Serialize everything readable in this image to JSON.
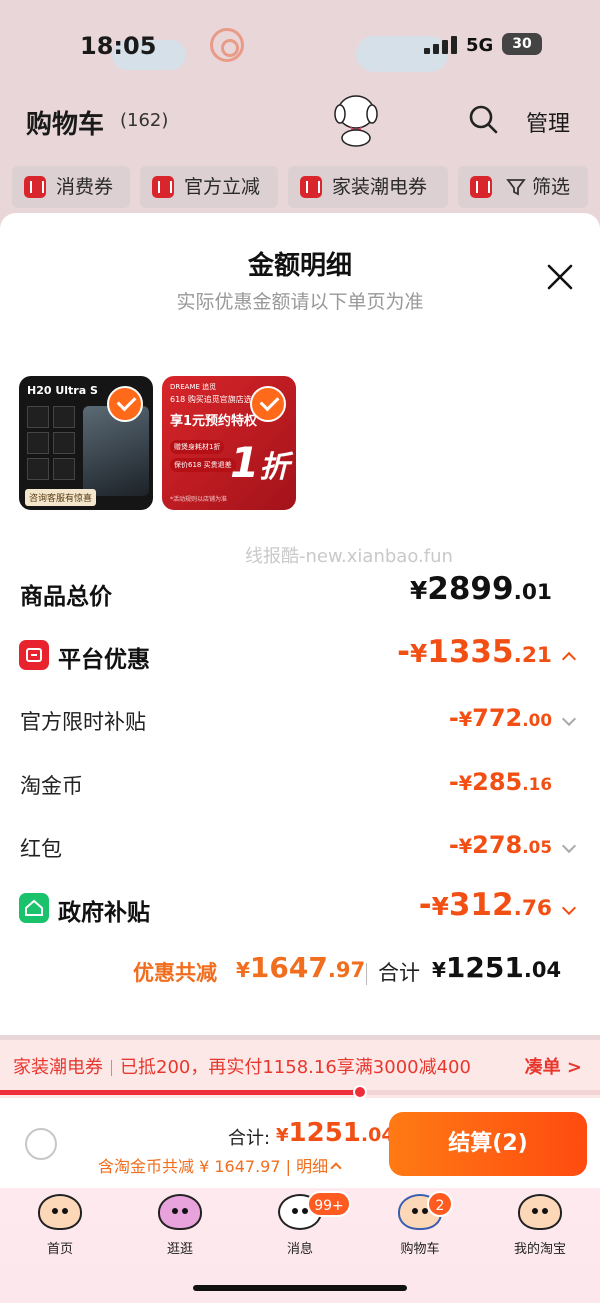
{
  "status_bar": {
    "time": "18:05",
    "network": "5G",
    "battery": "30"
  },
  "cart": {
    "title": "购物车",
    "count": "(162)",
    "manage": "管理"
  },
  "chips": [
    {
      "label": "消费券"
    },
    {
      "label": "官方立减"
    },
    {
      "label": "家装潮电券"
    },
    {
      "label": "筛选"
    }
  ],
  "sheet": {
    "title": "金额明细",
    "subtitle": "实际优惠金额请以下单页为准",
    "watermark": "线报酷-new.xianbao.fun",
    "products": [
      {
        "title": "H20 Ultra S",
        "tag": "咨询客服有惊喜"
      },
      {
        "brand": "DREAME 追觅",
        "line1": "618 购买追觅官旗店选地机",
        "line2": "享1元预约特权",
        "pill1": "赠煲身耗材1折",
        "pill2": "保价618 买贵退差",
        "big": "1",
        "big_unit": "折",
        "foot": "*活动规则以店铺为准"
      }
    ],
    "rows": {
      "total": {
        "label": "商品总价",
        "yen": "¥",
        "int": "2899",
        "dec": ".01"
      },
      "platform": {
        "label": "平台优惠",
        "sign": "-",
        "yen": "¥",
        "int": "1335",
        "dec": ".21"
      },
      "official": {
        "label": "官方限时补贴",
        "sign": "-",
        "yen": "¥",
        "int": "772",
        "dec": ".00"
      },
      "coins": {
        "label": "淘金币",
        "sign": "-",
        "yen": "¥",
        "int": "285",
        "dec": ".16"
      },
      "redpack": {
        "label": "红包",
        "sign": "-",
        "yen": "¥",
        "int": "278",
        "dec": ".05"
      },
      "gov": {
        "label": "政府补贴",
        "sign": "-",
        "yen": "¥",
        "int": "312",
        "dec": ".76"
      }
    },
    "summary": {
      "saving_label": "优惠共减",
      "saving_yen": "¥",
      "saving_int": "1647",
      "saving_dec": ".97",
      "sum_label": "合计",
      "sum_yen": "¥",
      "sum_int": "1251",
      "sum_dec": ".04"
    }
  },
  "promo": {
    "name": "家装潮电券",
    "text": "已抵200，再实付1158.16享满3000减400",
    "link": "凑单 >",
    "progress": 0.6
  },
  "checkout": {
    "label": "合计:",
    "yen": "¥",
    "int": "1251",
    "dec": ".04",
    "sub": "含淘金币共减 ¥ 1647.97 | 明细",
    "button": "结算(2)"
  },
  "tabs": [
    {
      "label": "首页"
    },
    {
      "label": "逛逛"
    },
    {
      "label": "消息",
      "badge": "99+"
    },
    {
      "label": "购物车",
      "badge": "2"
    },
    {
      "label": "我的淘宝"
    }
  ],
  "colors": {
    "accent": "#f24f14",
    "promo_red": "#e8382e",
    "button": "#ff5a14",
    "gov_green": "#19c26b",
    "platform_red": "#e8232d"
  }
}
